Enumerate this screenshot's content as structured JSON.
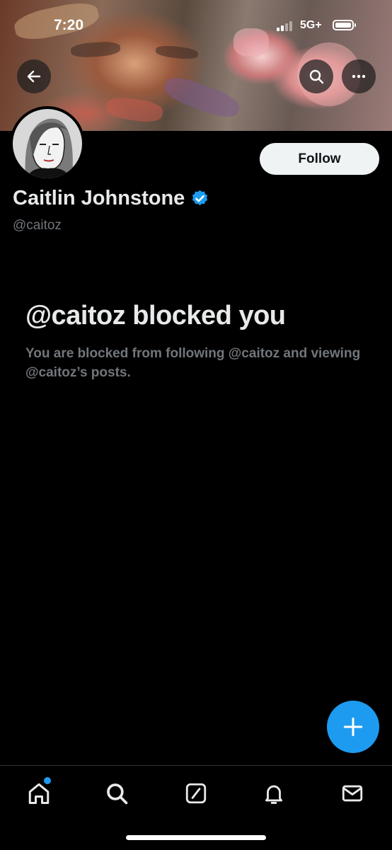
{
  "status_bar": {
    "time": "7:20",
    "network": "5G+"
  },
  "header": {
    "back_icon": "arrow-left-icon",
    "search_icon": "search-icon",
    "more_icon": "more-horizontal-icon"
  },
  "profile": {
    "name": "Caitlin Johnstone",
    "handle": "@caitoz",
    "verified": true,
    "follow_label": "Follow"
  },
  "blocked": {
    "title": "@caitoz blocked you",
    "description": "You are blocked from following @caitoz and viewing @caitoz’s posts."
  },
  "compose": {
    "icon": "plus-icon"
  },
  "tabbar": {
    "items": [
      {
        "name": "home",
        "icon": "home-icon",
        "notification_dot": true
      },
      {
        "name": "search",
        "icon": "search-icon"
      },
      {
        "name": "grok",
        "icon": "grok-icon"
      },
      {
        "name": "notifications",
        "icon": "bell-icon"
      },
      {
        "name": "messages",
        "icon": "envelope-icon"
      }
    ]
  },
  "colors": {
    "accent": "#1d9bf0",
    "background": "#000000",
    "secondary_text": "#71767b"
  }
}
